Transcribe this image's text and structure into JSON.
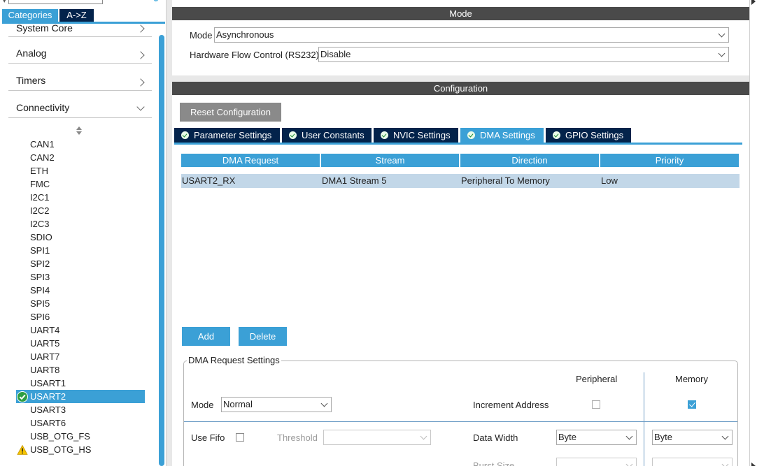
{
  "left_panel": {
    "tabs": {
      "categories": "Categories",
      "atoz": "A->Z"
    },
    "categories": [
      {
        "label": "System Core",
        "expanded": false
      },
      {
        "label": "Analog",
        "expanded": false
      },
      {
        "label": "Timers",
        "expanded": false
      },
      {
        "label": "Connectivity",
        "expanded": true
      }
    ],
    "peripherals": [
      {
        "label": "CAN1",
        "status": "none"
      },
      {
        "label": "CAN2",
        "status": "none"
      },
      {
        "label": "ETH",
        "status": "none"
      },
      {
        "label": "FMC",
        "status": "none"
      },
      {
        "label": "I2C1",
        "status": "none"
      },
      {
        "label": "I2C2",
        "status": "none"
      },
      {
        "label": "I2C3",
        "status": "none"
      },
      {
        "label": "SDIO",
        "status": "none"
      },
      {
        "label": "SPI1",
        "status": "none"
      },
      {
        "label": "SPI2",
        "status": "none"
      },
      {
        "label": "SPI3",
        "status": "none"
      },
      {
        "label": "SPI4",
        "status": "none"
      },
      {
        "label": "SPI5",
        "status": "none"
      },
      {
        "label": "SPI6",
        "status": "none"
      },
      {
        "label": "UART4",
        "status": "none"
      },
      {
        "label": "UART5",
        "status": "none"
      },
      {
        "label": "UART7",
        "status": "none"
      },
      {
        "label": "UART8",
        "status": "none"
      },
      {
        "label": "USART1",
        "status": "none"
      },
      {
        "label": "USART2",
        "status": "ok",
        "selected": true
      },
      {
        "label": "USART3",
        "status": "none"
      },
      {
        "label": "USART6",
        "status": "none"
      },
      {
        "label": "USB_OTG_FS",
        "status": "none"
      },
      {
        "label": "USB_OTG_HS",
        "status": "warning"
      }
    ],
    "colors": {
      "accent": "#3ba0d6",
      "navy": "#03234b",
      "selected_row": "#3ba0d6",
      "warning": "#f5c400",
      "ok": "#1d8a2f"
    }
  },
  "mode": {
    "header": "Mode",
    "fields": {
      "mode_label": "Mode",
      "mode_value": "Asynchronous",
      "flow_label": "Hardware Flow Control (RS232)",
      "flow_value": "Disable"
    }
  },
  "configuration": {
    "header": "Configuration",
    "reset_label": "Reset Configuration",
    "tabs": [
      {
        "label": "Parameter Settings",
        "active": false
      },
      {
        "label": "User Constants",
        "active": false
      },
      {
        "label": "NVIC Settings",
        "active": false
      },
      {
        "label": "DMA Settings",
        "active": true
      },
      {
        "label": "GPIO Settings",
        "active": false
      }
    ],
    "dma_table": {
      "columns": [
        "DMA Request",
        "Stream",
        "Direction",
        "Priority"
      ],
      "rows": [
        [
          "USART2_RX",
          "DMA1 Stream 5",
          "Peripheral To Memory",
          "Low"
        ]
      ]
    },
    "add_label": "Add",
    "delete_label": "Delete",
    "request_settings": {
      "title": "DMA Request Settings",
      "peripheral_header": "Peripheral",
      "memory_header": "Memory",
      "mode_label": "Mode",
      "mode_value": "Normal",
      "increment_label": "Increment Address",
      "increment_peripheral": false,
      "increment_memory": true,
      "fifo_label": "Use Fifo",
      "fifo_checked": false,
      "threshold_label": "Threshold",
      "threshold_value": "",
      "data_width_label": "Data Width",
      "data_width_peripheral": "Byte",
      "data_width_memory": "Byte",
      "burst_size_label": "Burst Size"
    }
  }
}
